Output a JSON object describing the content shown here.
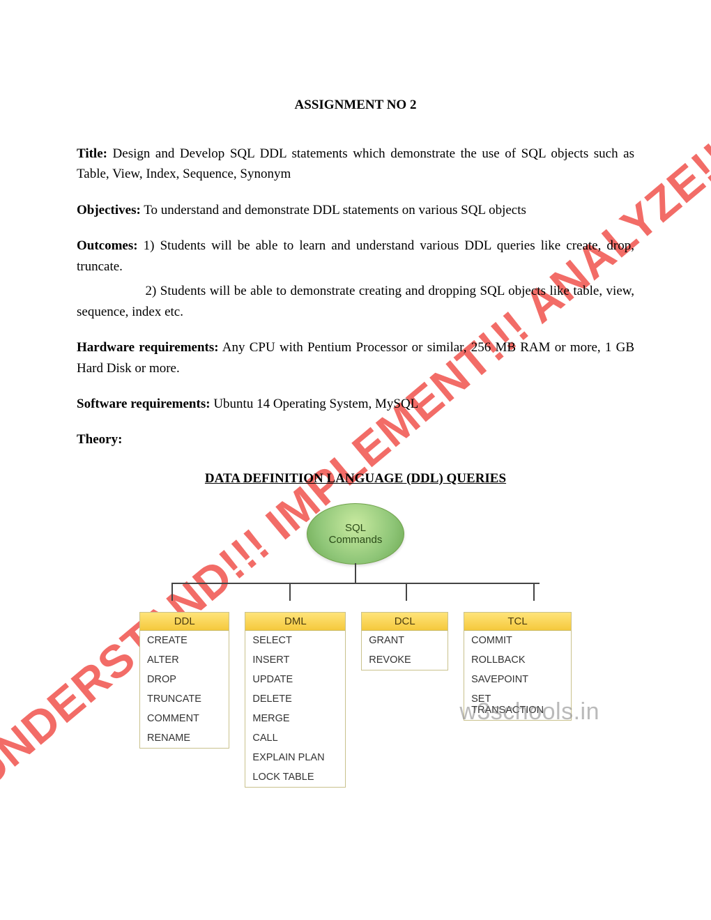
{
  "watermark": "UNDERSTAND!!! IMPLEMENT!!! ANALYZE!!!",
  "header": {
    "title": "ASSIGNMENT NO 2"
  },
  "sections": {
    "title_label": "Title:",
    "title_text": "  Design and Develop SQL DDL statements which demonstrate the use of SQL objects such as Table, View, Index, Sequence, Synonym",
    "objectives_label": "Objectives:",
    "objectives_text": "  To understand and demonstrate DDL statements on various SQL objects",
    "outcomes_label": "Outcomes:",
    "outcomes_text1": " 1) Students will be able to learn and understand various DDL queries like create, drop, truncate.",
    "outcomes_text2": "                  2) Students will be able to demonstrate creating and dropping SQL objects like table, view, sequence, index etc.",
    "hw_label": "Hardware requirements:",
    "hw_text": " Any CPU with Pentium Processor or similar, 256 MB RAM or more, 1 GB Hard Disk or more.",
    "sw_label": "Software requirements:",
    "sw_text": "  Ubuntu 14 Operating System, MySQL",
    "theory_label": "Theory:",
    "ddl_heading": "DATA DEFINITION LANGUAGE (DDL) QUERIES"
  },
  "diagram": {
    "root": "SQL\nCommands",
    "attribution": "w3schools.in",
    "groups": [
      {
        "head": "DDL",
        "items": [
          "CREATE",
          "ALTER",
          "DROP",
          "TRUNCATE",
          "COMMENT",
          "RENAME"
        ]
      },
      {
        "head": "DML",
        "items": [
          "SELECT",
          "INSERT",
          "UPDATE",
          "DELETE",
          "MERGE",
          "CALL",
          "EXPLAIN PLAN",
          "LOCK TABLE"
        ]
      },
      {
        "head": "DCL",
        "items": [
          "GRANT",
          "REVOKE"
        ]
      },
      {
        "head": "TCL",
        "items": [
          "COMMIT",
          "ROLLBACK",
          "SAVEPOINT",
          "SET TRANSACTION"
        ]
      }
    ]
  }
}
